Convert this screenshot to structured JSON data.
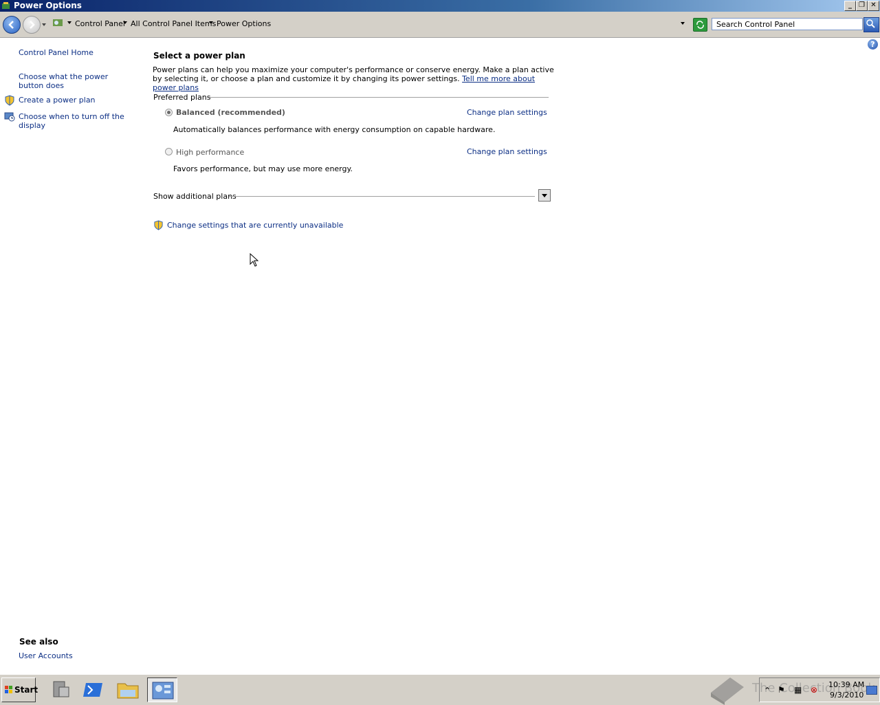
{
  "window": {
    "title": "Power Options"
  },
  "address_bar": {
    "breadcrumbs": [
      "Control Panel",
      "All Control Panel Items",
      "Power Options"
    ],
    "search_placeholder": "Search Control Panel"
  },
  "left_pane": {
    "home_link": "Control Panel Home",
    "items": [
      {
        "label": "Choose what the power button does",
        "icon": "none"
      },
      {
        "label": "Create a power plan",
        "icon": "shield-icon"
      },
      {
        "label": "Choose when to turn off the display",
        "icon": "monitor-clock-icon"
      }
    ],
    "see_also_title": "See also",
    "see_also_items": [
      "User Accounts"
    ]
  },
  "main": {
    "title": "Select a power plan",
    "intro": "Power plans can help you maximize your computer's performance or conserve energy. Make a plan active by selecting it, or choose a plan and customize it by changing its power settings.",
    "intro_link": "Tell me more about power plans",
    "preferred_label": "Preferred plans",
    "plans": [
      {
        "name": "Balanced (recommended)",
        "description": "Automatically balances performance with energy consumption on capable hardware.",
        "link": "Change plan settings",
        "selected": true
      },
      {
        "name": "High performance",
        "description": "Favors performance, but may use more energy.",
        "link": "Change plan settings",
        "selected": false
      }
    ],
    "additional_label": "Show additional plans",
    "unavailable_link": "Change settings that are currently unavailable"
  },
  "help_icon_label": "?",
  "taskbar": {
    "start_label": "Start",
    "clock_time": "10:39 AM",
    "clock_date": "9/3/2010",
    "watermark": "The Collection Book"
  },
  "colors": {
    "link": "#0b2e84",
    "titlebar": "#0a246a",
    "chrome": "#d4d0c8"
  }
}
